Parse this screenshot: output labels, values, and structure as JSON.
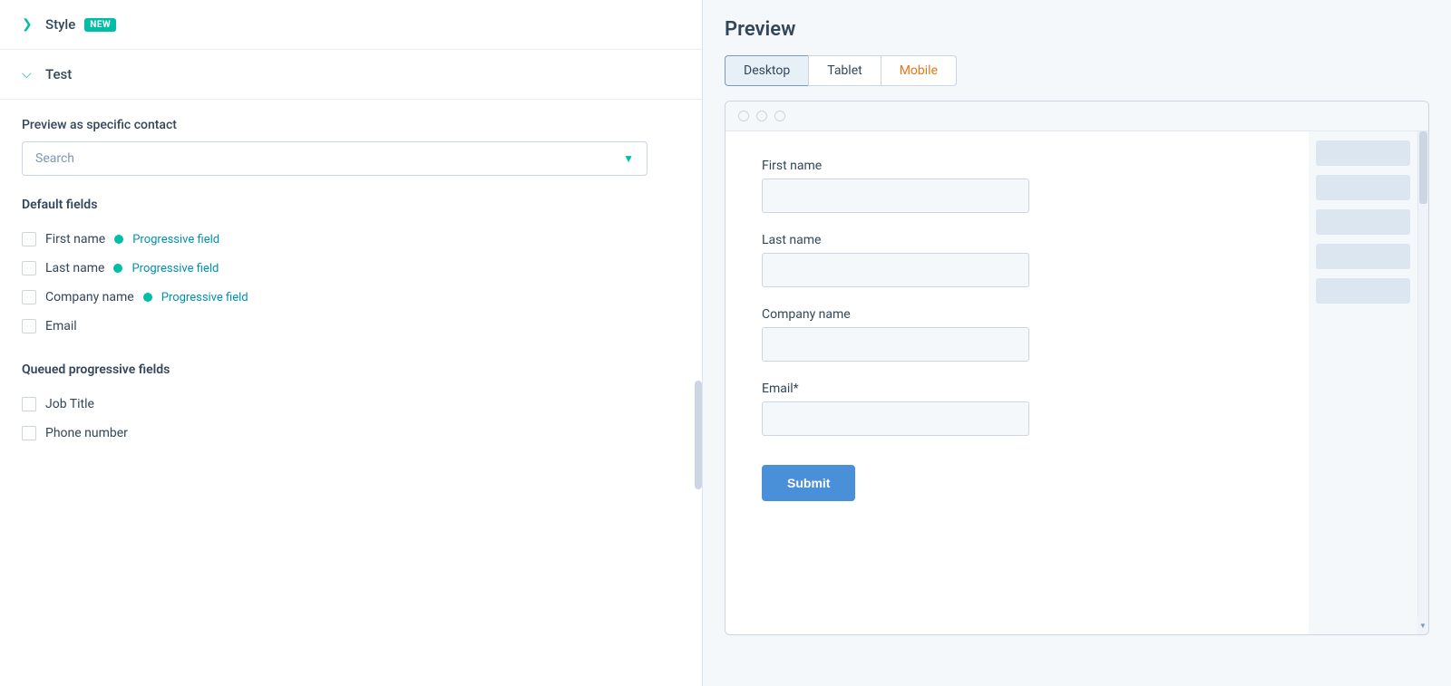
{
  "left": {
    "style_section": {
      "label": "Style",
      "badge": "NEW",
      "collapsed": true
    },
    "test_section": {
      "label": "Test",
      "collapsed": false
    },
    "preview_contact": {
      "label": "Preview as specific contact",
      "search_placeholder": "Search"
    },
    "default_fields": {
      "title": "Default fields",
      "items": [
        {
          "name": "First name",
          "progressive": true,
          "progressive_label": "Progressive field"
        },
        {
          "name": "Last name",
          "progressive": true,
          "progressive_label": "Progressive field"
        },
        {
          "name": "Company name",
          "progressive": true,
          "progressive_label": "Progressive field"
        },
        {
          "name": "Email",
          "progressive": false
        }
      ]
    },
    "queued_fields": {
      "title": "Queued progressive fields",
      "items": [
        {
          "name": "Job Title",
          "progressive": false
        },
        {
          "name": "Phone number",
          "progressive": false
        }
      ]
    }
  },
  "right": {
    "title": "Preview",
    "tabs": [
      {
        "label": "Desktop",
        "active": true
      },
      {
        "label": "Tablet",
        "active": false
      },
      {
        "label": "Mobile",
        "active": false
      }
    ],
    "form": {
      "fields": [
        {
          "label": "First name",
          "required": false
        },
        {
          "label": "Last name",
          "required": false
        },
        {
          "label": "Company name",
          "required": false
        },
        {
          "label": "Email*",
          "required": true
        }
      ],
      "submit_label": "Submit"
    }
  }
}
